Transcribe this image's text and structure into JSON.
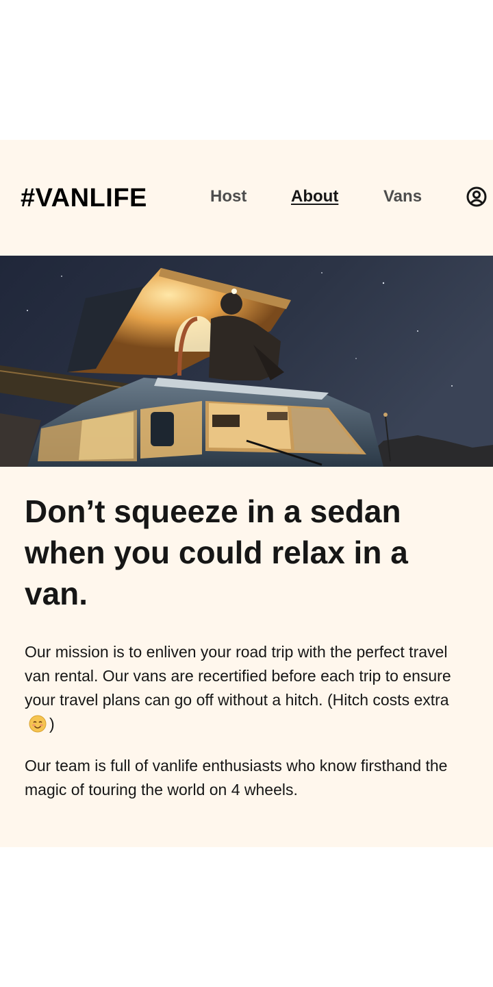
{
  "header": {
    "logo": "#VANLIFE",
    "nav": {
      "host": "Host",
      "about": "About",
      "vans": "Vans"
    },
    "profile_icon": "user-circle-icon"
  },
  "hero": {
    "image": "van-at-night-photo"
  },
  "main": {
    "headline": "Don’t squeeze in a sedan when you could relax in a van.",
    "paragraph1_text": "Our mission is to enliven your road trip with the perfect travel van rental. Our vans are recertified before each trip to ensure your travel plans can go off without a hitch. (Hitch costs extra",
    "paragraph1_close": ")",
    "paragraph1_emoji": "smiling-face-emoji",
    "paragraph2": "Our team is full of vanlife enthusiasts who know firsthand the magic of touring the world on 4 wheels."
  },
  "colors": {
    "page_background": "#FFF7ED",
    "text": "#161616",
    "nav_inactive": "#4D4D4D"
  }
}
